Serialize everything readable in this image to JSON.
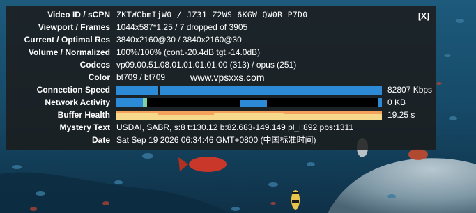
{
  "overlay": {
    "close_label": "[X]",
    "watermark": "www.vpsxxs.com",
    "rows": {
      "video_id": {
        "label": "Video ID / sCPN",
        "value": "ZKTWCbmIjW0 / JZ31 Z2WS 6KGW QW0R P7D0"
      },
      "viewport": {
        "label": "Viewport / Frames",
        "value": "1044x587*1.25 / 7 dropped of 3905"
      },
      "resolution": {
        "label": "Current / Optimal Res",
        "value": "3840x2160@30 / 3840x2160@30"
      },
      "volume": {
        "label": "Volume / Normalized",
        "value": "100%/100% (cont.-20.4dB tgt.-14.0dB)"
      },
      "codecs": {
        "label": "Codecs",
        "value": "vp09.00.51.08.01.01.01.01.00 (313) / opus (251)"
      },
      "color": {
        "label": "Color",
        "value": "bt709 / bt709"
      },
      "connection": {
        "label": "Connection Speed",
        "value": "82807 Kbps"
      },
      "network": {
        "label": "Network Activity",
        "value": "0 KB"
      },
      "buffer": {
        "label": "Buffer Health",
        "value": "19.25 s"
      },
      "mystery": {
        "label": "Mystery Text",
        "value": "USDAI, SABR, s:8 t:130.12 b:82.683-149.149 pl_i:892 pbs:1311"
      },
      "date": {
        "label": "Date",
        "value": "Sat Sep 19 2026 06:34:46 GMT+0800 (中国标准时间)"
      }
    }
  },
  "colors": {
    "connection_bar": "#2d8ad6",
    "network_bar": "#2d8ad6",
    "buffer_bg": "#f5a35c",
    "buffer_fill": "#f7d98b",
    "panel_bg": "#1c1c1c"
  }
}
